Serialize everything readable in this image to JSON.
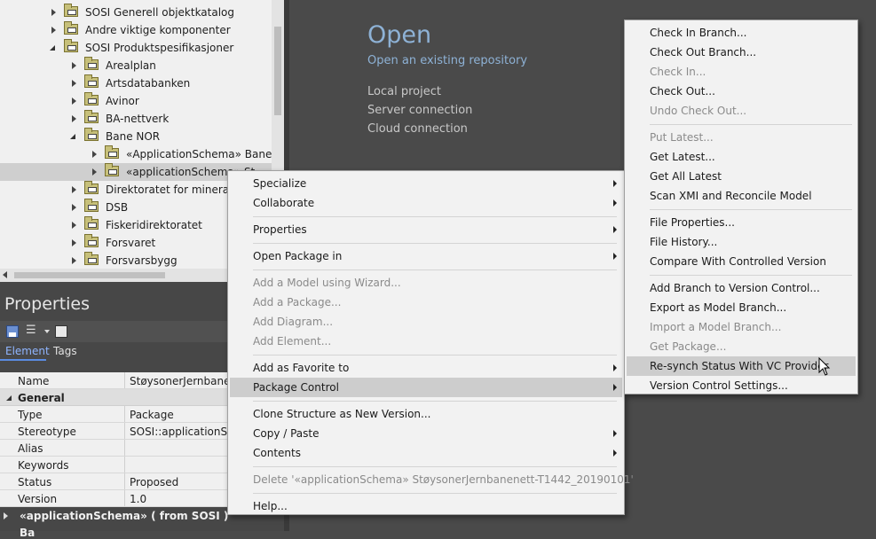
{
  "tree": {
    "items": [
      {
        "label": "SOSI Generell objektkatalog",
        "state": "collapsed"
      },
      {
        "label": "Andre viktige komponenter",
        "state": "collapsed"
      },
      {
        "label": "SOSI Produktspesifikasjoner",
        "state": "expanded"
      },
      {
        "label": "Arealplan",
        "state": "collapsed"
      },
      {
        "label": "Artsdatabanken",
        "state": "collapsed"
      },
      {
        "label": "Avinor",
        "state": "collapsed"
      },
      {
        "label": "BA-nettverk",
        "state": "collapsed"
      },
      {
        "label": "Bane NOR",
        "state": "expanded"
      },
      {
        "label": "«ApplicationSchema» Banenet",
        "state": "collapsed"
      },
      {
        "label": "«applicationSchema» St",
        "state": "collapsed",
        "selected": true
      },
      {
        "label": "Direktoratet for mineralfo",
        "state": "collapsed"
      },
      {
        "label": "DSB",
        "state": "collapsed"
      },
      {
        "label": "Fiskeridirektoratet",
        "state": "collapsed"
      },
      {
        "label": "Forsvaret",
        "state": "collapsed"
      },
      {
        "label": "Forsvarsbygg",
        "state": "collapsed"
      }
    ]
  },
  "properties": {
    "title": "Properties",
    "tabs": [
      "Element",
      "Tags"
    ],
    "name_row": {
      "key": "Name",
      "value": "StøysonerJernbanene"
    },
    "group_general": "General",
    "rows": [
      {
        "key": "Type",
        "value": "Package"
      },
      {
        "key": "Stereotype",
        "value": "SOSI::applicationSche"
      },
      {
        "key": "Alias",
        "value": ""
      },
      {
        "key": "Keywords",
        "value": ""
      },
      {
        "key": "Status",
        "value": "Proposed"
      },
      {
        "key": "Version",
        "value": "1.0"
      }
    ],
    "section": "«applicationSchema» ( from SOSI )",
    "bottom_cut": "Ba"
  },
  "start_page": {
    "title": "Open",
    "subtitle": "Open an existing repository",
    "links": [
      "Local project",
      "Server connection",
      "Cloud connection"
    ]
  },
  "context_menu": [
    {
      "label": "Specialize",
      "submenu": true
    },
    {
      "label": "Collaborate",
      "submenu": true
    },
    {
      "sep": true
    },
    {
      "label": "Properties",
      "submenu": true
    },
    {
      "sep": true
    },
    {
      "label": "Open Package in",
      "submenu": true
    },
    {
      "sep": true
    },
    {
      "label": "Add a Model using Wizard...",
      "disabled": true
    },
    {
      "label": "Add a Package...",
      "disabled": true
    },
    {
      "label": "Add Diagram...",
      "disabled": true
    },
    {
      "label": "Add Element...",
      "disabled": true
    },
    {
      "sep": true
    },
    {
      "label": "Add as Favorite to",
      "submenu": true
    },
    {
      "label": "Package Control",
      "submenu": true,
      "hover": true
    },
    {
      "sep": true
    },
    {
      "label": "Clone Structure as New Version..."
    },
    {
      "label": "Copy / Paste",
      "submenu": true
    },
    {
      "label": "Contents",
      "submenu": true
    },
    {
      "sep": true
    },
    {
      "label": "Delete '«applicationSchema» StøysonerJernbanenett-T1442_20190101'",
      "disabled": true
    },
    {
      "sep": true
    },
    {
      "label": "Help..."
    }
  ],
  "submenu": [
    {
      "label": "Check In Branch..."
    },
    {
      "label": "Check Out Branch..."
    },
    {
      "label": "Check In...",
      "disabled": true
    },
    {
      "label": "Check Out..."
    },
    {
      "label": "Undo Check Out...",
      "disabled": true
    },
    {
      "sep": true
    },
    {
      "label": "Put Latest...",
      "disabled": true
    },
    {
      "label": "Get Latest..."
    },
    {
      "label": "Get All Latest"
    },
    {
      "label": "Scan XMI and Reconcile Model"
    },
    {
      "sep": true
    },
    {
      "label": "File Properties..."
    },
    {
      "label": "File History..."
    },
    {
      "label": "Compare With Controlled Version"
    },
    {
      "sep": true
    },
    {
      "label": "Add Branch to Version Control..."
    },
    {
      "label": "Export as Model Branch..."
    },
    {
      "label": "Import a Model Branch...",
      "disabled": true
    },
    {
      "label": "Get Package...",
      "disabled": true
    },
    {
      "label": "Re-synch Status With VC Provider",
      "hover": true
    },
    {
      "label": "Version Control Settings..."
    }
  ]
}
